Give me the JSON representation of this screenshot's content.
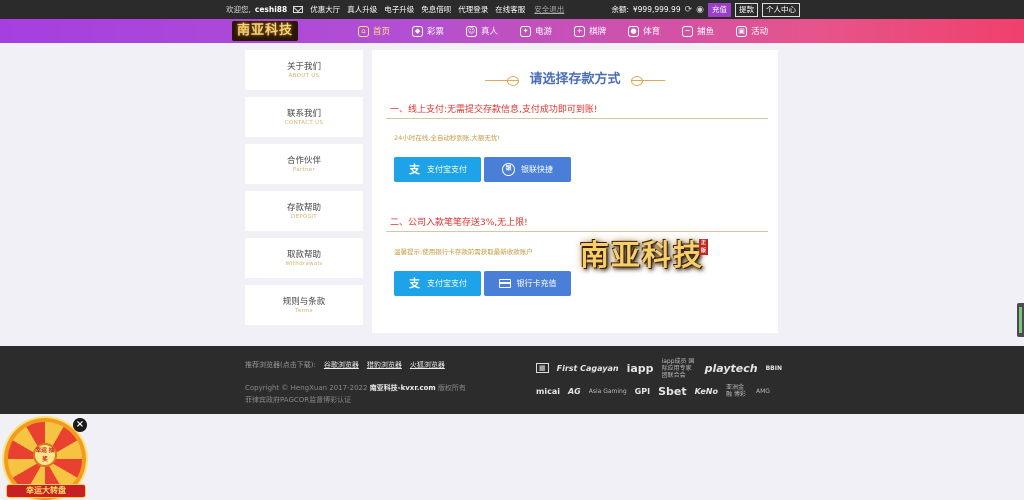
{
  "topbar": {
    "welcome": "欢迎您,",
    "username": "ceshi88",
    "mail_icon": "mail-icon",
    "links": [
      "优惠大厅",
      "真人升级",
      "电子升级",
      "免息借呗",
      "代理登录",
      "在线客服"
    ],
    "logout": "安全退出",
    "balance_label": "余额:",
    "balance": "¥999,999.99",
    "refresh_icon": "refresh-icon",
    "eye_icon": "eye-icon",
    "btn_deposit": "充值",
    "btn_withdraw": "提款",
    "btn_center": "个人中心"
  },
  "nav": {
    "logo": "南亚科技",
    "items": [
      {
        "label": "首页",
        "icon": "home-icon"
      },
      {
        "label": "彩票",
        "icon": "lottery-icon"
      },
      {
        "label": "真人",
        "icon": "live-icon"
      },
      {
        "label": "电游",
        "icon": "gamepad-icon"
      },
      {
        "label": "棋牌",
        "icon": "chess-icon"
      },
      {
        "label": "体育",
        "icon": "ball-icon"
      },
      {
        "label": "捕鱼",
        "icon": "fish-icon"
      },
      {
        "label": "活动",
        "icon": "gift-icon"
      }
    ]
  },
  "sidebar": {
    "items": [
      {
        "cn": "关于我们",
        "en": "ABOUT US"
      },
      {
        "cn": "联系我们",
        "en": "CONTACT US"
      },
      {
        "cn": "合作伙伴",
        "en": "Partner"
      },
      {
        "cn": "存款帮助",
        "en": "DEPOSIT"
      },
      {
        "cn": "取款帮助",
        "en": "Withdrawals"
      },
      {
        "cn": "规则与条款",
        "en": "Terms"
      }
    ]
  },
  "main": {
    "title": "请选择存款方式",
    "section1": {
      "title": "一、线上支付:无需提交存款信息,支付成功即可到账!",
      "note": "24小时在线,全自动秒到账,大额无忧!",
      "buttons": [
        {
          "label": "支付宝支付",
          "icon": "alipay-icon"
        },
        {
          "label": "银联快捷",
          "icon": "unionpay-icon"
        }
      ]
    },
    "section2": {
      "title": "二、公司入款笔笔存送3%,无上限!",
      "note": "温馨提示:使用银行卡存款前需获取最新收款账户",
      "buttons": [
        {
          "label": "支付宝支付",
          "icon": "alipay-icon"
        },
        {
          "label": "银行卡充值",
          "icon": "bank-card-icon"
        }
      ]
    },
    "brand_overlay": "南亚科技",
    "brand_stamp": "正版"
  },
  "footer": {
    "browser_label": "推荐浏览器(点击下载):",
    "browsers": [
      "谷歌浏览器",
      "猎豹浏览器",
      "火狐浏览器"
    ],
    "copyright_prefix": "Copyright © HengXuan 2017-2022",
    "site": "南亚科技-kvxr.com",
    "copyright_suffix": "版权所有",
    "cert": "菲律宾政府PAGCOR监督博彩认证",
    "partners_row1": [
      "First Cagayan",
      "iapp",
      "iapp成员 国际应用专家团联合会",
      "playtech",
      "BBIN"
    ],
    "partners_row2": [
      "micai",
      "AG",
      "Asia Gaming",
      "GPI",
      "Sbet",
      "KeNo",
      "亚洲金融 博彩",
      "AMG"
    ]
  },
  "wheel": {
    "hub": "幸运 抽奖",
    "banner": "幸运大转盘",
    "close": "×"
  }
}
